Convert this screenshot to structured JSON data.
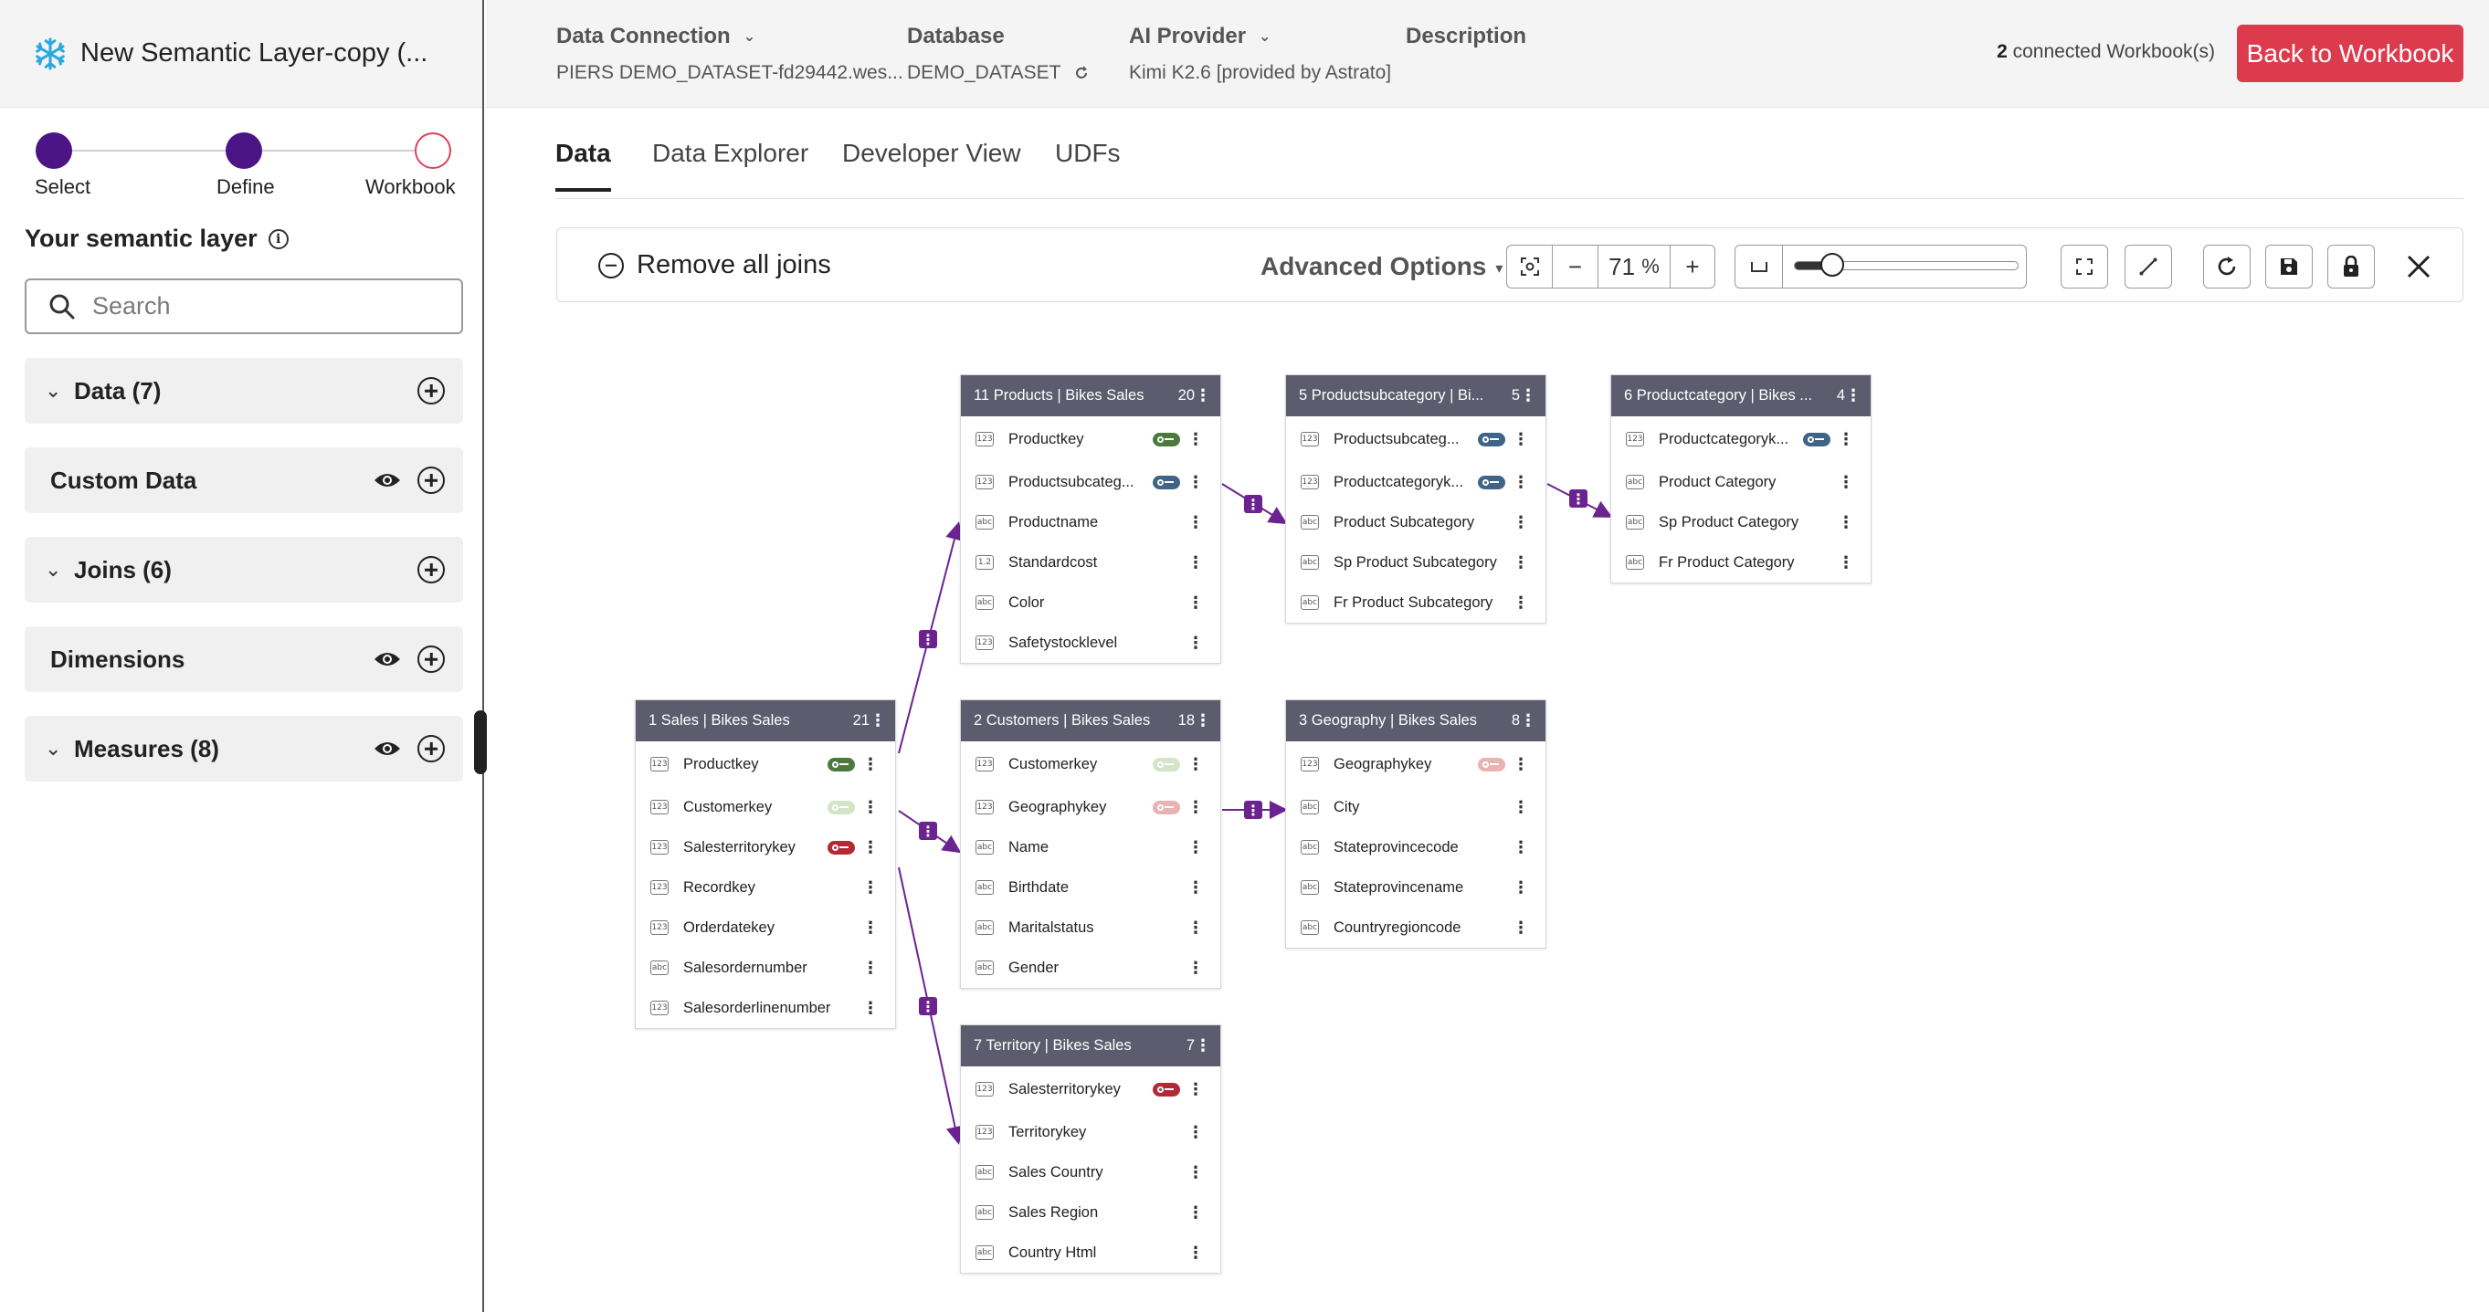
{
  "sidebar": {
    "title": "New Semantic Layer-copy (...",
    "steps": [
      "Select",
      "Define",
      "Workbook"
    ],
    "semantic_layer_title": "Your semantic layer",
    "search_placeholder": "Search",
    "sections": [
      {
        "label": "Data (7)"
      },
      {
        "label": "Custom Data"
      },
      {
        "label": "Joins (6)"
      },
      {
        "label": "Dimensions"
      },
      {
        "label": "Measures (8)"
      }
    ]
  },
  "header": {
    "data_connection_label": "Data Connection",
    "data_connection_value": "PIERS DEMO_DATASET-fd29442.wes...",
    "database_label": "Database",
    "database_value": "DEMO_DATASET",
    "ai_provider_label": "AI Provider",
    "ai_provider_value": "Kimi K2.6 [provided by Astrato]",
    "description_label": "Description",
    "connected_count": "2",
    "connected_text": "connected Workbook(s)",
    "back_button": "Back to Workbook"
  },
  "tabs": [
    "Data",
    "Data Explorer",
    "Developer View",
    "UDFs"
  ],
  "toolbar": {
    "remove_joins": "Remove all joins",
    "advanced_options": "Advanced Options",
    "zoom_minus": "−",
    "zoom_value": "71",
    "zoom_unit": "%",
    "zoom_plus": "+",
    "slider_level": 0.17
  },
  "tables": [
    {
      "header": "11 Products  |  Bikes Sales",
      "count": "20",
      "rows": [
        {
          "type": "123",
          "name": "Productkey",
          "key": "green"
        },
        {
          "type": "123",
          "name": "Productsubcateg...",
          "key": "blue"
        },
        {
          "type": "abc",
          "name": "Productname"
        },
        {
          "type": "1.2",
          "name": "Standardcost"
        },
        {
          "type": "abc",
          "name": "Color"
        },
        {
          "type": "123",
          "name": "Safetystocklevel"
        }
      ]
    },
    {
      "header": "5 Productsubcategory  |  Bi...",
      "count": "5",
      "rows": [
        {
          "type": "123",
          "name": "Productsubcateg...",
          "key": "blue"
        },
        {
          "type": "123",
          "name": "Productcategoryk...",
          "key": "blue"
        },
        {
          "type": "abc",
          "name": "Product Subcategory"
        },
        {
          "type": "abc",
          "name": "Sp Product Subcategory"
        },
        {
          "type": "abc",
          "name": "Fr Product Subcategory"
        }
      ]
    },
    {
      "header": "6 Productcategory  |  Bikes ...",
      "count": "4",
      "rows": [
        {
          "type": "123",
          "name": "Productcategoryk...",
          "key": "blue"
        },
        {
          "type": "abc",
          "name": "Product Category"
        },
        {
          "type": "abc",
          "name": "Sp Product Category"
        },
        {
          "type": "abc",
          "name": "Fr Product Category"
        }
      ]
    },
    {
      "header": "1 Sales  |  Bikes Sales",
      "count": "21",
      "rows": [
        {
          "type": "123",
          "name": "Productkey",
          "key": "green"
        },
        {
          "type": "123",
          "name": "Customerkey",
          "key": "lightgreen"
        },
        {
          "type": "123",
          "name": "Salesterritorykey",
          "key": "red"
        },
        {
          "type": "123",
          "name": "Recordkey"
        },
        {
          "type": "123",
          "name": "Orderdatekey"
        },
        {
          "type": "abc",
          "name": "Salesordernumber"
        },
        {
          "type": "123",
          "name": "Salesorderlinenumber"
        }
      ]
    },
    {
      "header": "2 Customers  |  Bikes Sales",
      "count": "18",
      "rows": [
        {
          "type": "123",
          "name": "Customerkey",
          "key": "lightgreen"
        },
        {
          "type": "123",
          "name": "Geographykey",
          "key": "lightred"
        },
        {
          "type": "abc",
          "name": "Name"
        },
        {
          "type": "abc",
          "name": "Birthdate"
        },
        {
          "type": "abc",
          "name": "Maritalstatus"
        },
        {
          "type": "abc",
          "name": "Gender"
        }
      ]
    },
    {
      "header": "3 Geography  |  Bikes Sales",
      "count": "8",
      "rows": [
        {
          "type": "123",
          "name": "Geographykey",
          "key": "lightred"
        },
        {
          "type": "abc",
          "name": "City"
        },
        {
          "type": "abc",
          "name": "Stateprovincecode"
        },
        {
          "type": "abc",
          "name": "Stateprovincename"
        },
        {
          "type": "abc",
          "name": "Countryregioncode"
        }
      ]
    },
    {
      "header": "7 Territory  |  Bikes Sales",
      "count": "7",
      "rows": [
        {
          "type": "123",
          "name": "Salesterritorykey",
          "key": "red"
        },
        {
          "type": "123",
          "name": "Territorykey"
        },
        {
          "type": "abc",
          "name": "Sales Country"
        },
        {
          "type": "abc",
          "name": "Sales Region"
        },
        {
          "type": "abc",
          "name": "Country Html"
        }
      ]
    }
  ],
  "colors": {
    "accent": "#4b1585",
    "brand_red": "#dc3b4e",
    "table_header": "#5c5c6e",
    "join_line": "#6b2390"
  }
}
